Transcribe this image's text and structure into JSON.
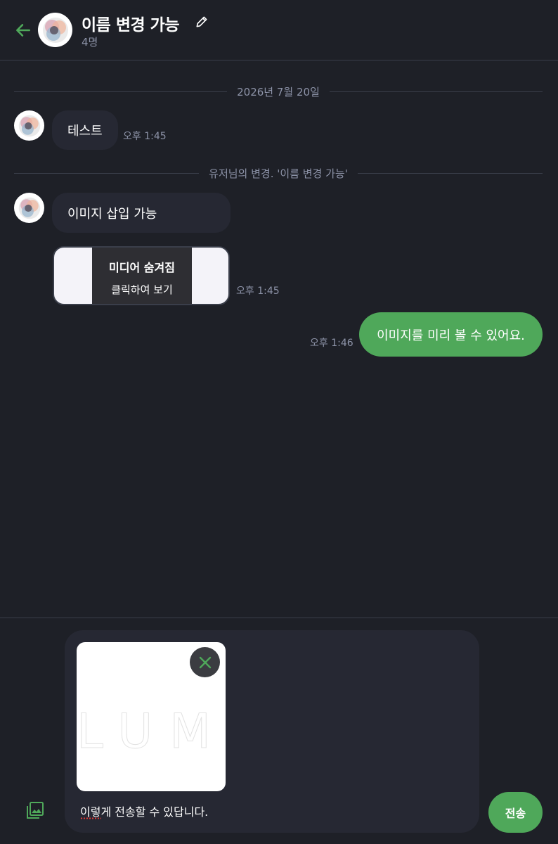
{
  "header": {
    "title": "이름 변경 가능",
    "member_count": "4명",
    "icons": {
      "back": "arrow-left-icon",
      "edit": "pencil-icon",
      "avatar": "group-avatar"
    }
  },
  "separators": {
    "date": "2026년 7월 20일",
    "rename_notice": "유저님의 변경. '이름 변경 가능'"
  },
  "messages": [
    {
      "direction": "incoming",
      "text": "테스트",
      "time": "오후 1:45"
    },
    {
      "direction": "incoming",
      "text": "이미지 삽입 가능"
    },
    {
      "direction": "incoming",
      "type": "media",
      "media_title": "미디어 숨겨짐",
      "media_action": "클릭하여 보기",
      "time": "오후 1:45"
    },
    {
      "direction": "outgoing",
      "text": "이미지를 미리 볼 수 있어요.",
      "time": "오후 1:46"
    }
  ],
  "composer": {
    "preview_watermark": "LUM",
    "input_value": "이렇게 전송할 수 있답니다.",
    "send_label": "전송",
    "icons": {
      "remove": "close-icon",
      "attach": "image-gallery-icon"
    }
  },
  "colors": {
    "background": "#1e2027",
    "bubble_incoming": "#262833",
    "accent": "#4fa85a",
    "muted_text": "#8d93a8"
  }
}
